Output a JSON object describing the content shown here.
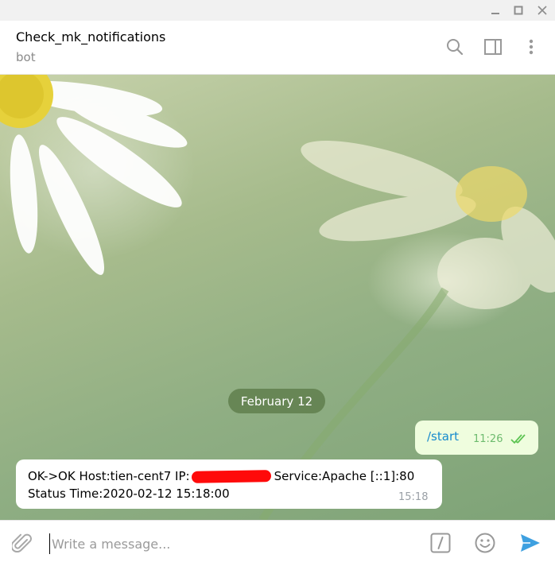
{
  "window": {
    "controls": {
      "minimize": "minimize-icon",
      "maximize": "maximize-icon",
      "close": "close-icon"
    }
  },
  "header": {
    "title": "Check_mk_notifications",
    "subtitle": "bot",
    "icons": [
      "search-icon",
      "sidebar-toggle-icon",
      "more-vert-icon"
    ]
  },
  "chat": {
    "date_label": "February 12",
    "messages": [
      {
        "direction": "outgoing",
        "text": "/start",
        "time": "11:26",
        "status": "read"
      },
      {
        "direction": "incoming",
        "line1_prefix": "OK->OK Host:tien-cent7 IP:",
        "line1_suffix": "Service:Apache [::1]:80",
        "line2": "Status Time:2020-02-12 15:18:00",
        "time": "15:18"
      }
    ]
  },
  "composer": {
    "placeholder": "Write a message...",
    "value": "",
    "icons": [
      "attach-icon",
      "commands-icon",
      "emoji-icon",
      "send-icon"
    ]
  },
  "colors": {
    "accent": "#3ea0e0",
    "outgoing_bubble": "#effdde",
    "read_check": "#5dc452",
    "redaction": "#ff0a0a"
  }
}
